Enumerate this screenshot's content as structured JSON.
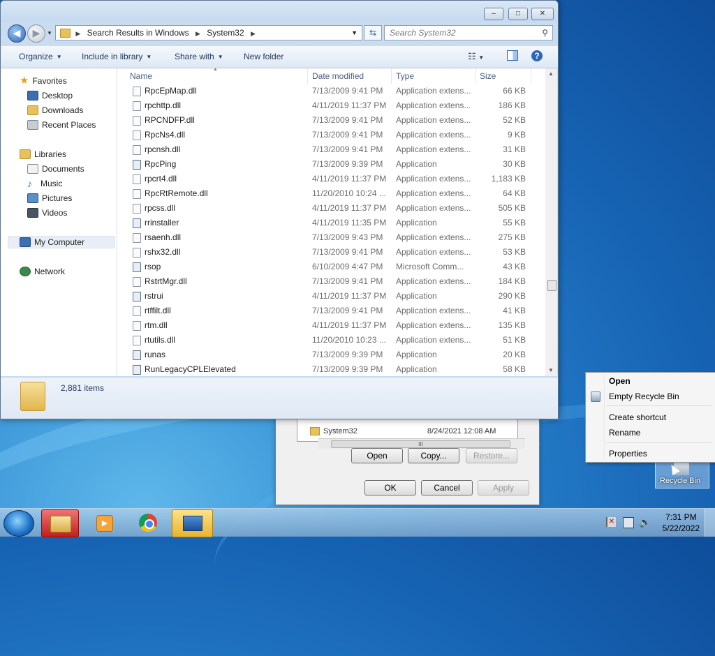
{
  "explorer": {
    "breadcrumb": [
      "Search Results in Windows",
      "System32"
    ],
    "search_placeholder": "Search System32",
    "commands": {
      "organize": "Organize",
      "include": "Include in library",
      "share": "Share with",
      "new_folder": "New folder"
    },
    "nav": {
      "favorites": "Favorites",
      "desktop": "Desktop",
      "downloads": "Downloads",
      "recent": "Recent Places",
      "libraries": "Libraries",
      "documents": "Documents",
      "music": "Music",
      "pictures": "Pictures",
      "videos": "Videos",
      "computer": "My Computer",
      "network": "Network"
    },
    "columns": {
      "name": "Name",
      "date": "Date modified",
      "type": "Type",
      "size": "Size"
    },
    "files": [
      {
        "name": "RpcEpMap.dll",
        "date": "7/13/2009 9:41 PM",
        "type": "Application extens...",
        "size": "66 KB",
        "kind": "dll"
      },
      {
        "name": "rpchttp.dll",
        "date": "4/11/2019 11:37 PM",
        "type": "Application extens...",
        "size": "186 KB",
        "kind": "dll"
      },
      {
        "name": "RPCNDFP.dll",
        "date": "7/13/2009 9:41 PM",
        "type": "Application extens...",
        "size": "52 KB",
        "kind": "dll"
      },
      {
        "name": "RpcNs4.dll",
        "date": "7/13/2009 9:41 PM",
        "type": "Application extens...",
        "size": "9 KB",
        "kind": "dll"
      },
      {
        "name": "rpcnsh.dll",
        "date": "7/13/2009 9:41 PM",
        "type": "Application extens...",
        "size": "31 KB",
        "kind": "dll"
      },
      {
        "name": "RpcPing",
        "date": "7/13/2009 9:39 PM",
        "type": "Application",
        "size": "30 KB",
        "kind": "app"
      },
      {
        "name": "rpcrt4.dll",
        "date": "4/11/2019 11:37 PM",
        "type": "Application extens...",
        "size": "1,183 KB",
        "kind": "dll"
      },
      {
        "name": "RpcRtRemote.dll",
        "date": "11/20/2010 10:24 ...",
        "type": "Application extens...",
        "size": "64 KB",
        "kind": "dll"
      },
      {
        "name": "rpcss.dll",
        "date": "4/11/2019 11:37 PM",
        "type": "Application extens...",
        "size": "505 KB",
        "kind": "dll"
      },
      {
        "name": "rrinstaller",
        "date": "4/11/2019 11:35 PM",
        "type": "Application",
        "size": "55 KB",
        "kind": "app"
      },
      {
        "name": "rsaenh.dll",
        "date": "7/13/2009 9:43 PM",
        "type": "Application extens...",
        "size": "275 KB",
        "kind": "dll"
      },
      {
        "name": "rshx32.dll",
        "date": "7/13/2009 9:41 PM",
        "type": "Application extens...",
        "size": "53 KB",
        "kind": "dll"
      },
      {
        "name": "rsop",
        "date": "6/10/2009 4:47 PM",
        "type": "Microsoft Comm...",
        "size": "43 KB",
        "kind": "msc"
      },
      {
        "name": "RstrtMgr.dll",
        "date": "7/13/2009 9:41 PM",
        "type": "Application extens...",
        "size": "184 KB",
        "kind": "dll"
      },
      {
        "name": "rstrui",
        "date": "4/11/2019 11:37 PM",
        "type": "Application",
        "size": "290 KB",
        "kind": "app"
      },
      {
        "name": "rtffilt.dll",
        "date": "7/13/2009 9:41 PM",
        "type": "Application extens...",
        "size": "41 KB",
        "kind": "dll"
      },
      {
        "name": "rtm.dll",
        "date": "4/11/2019 11:37 PM",
        "type": "Application extens...",
        "size": "135 KB",
        "kind": "dll"
      },
      {
        "name": "rtutils.dll",
        "date": "11/20/2010 10:23 ...",
        "type": "Application extens...",
        "size": "51 KB",
        "kind": "dll"
      },
      {
        "name": "runas",
        "date": "7/13/2009 9:39 PM",
        "type": "Application",
        "size": "20 KB",
        "kind": "app"
      },
      {
        "name": "RunLegacyCPLElevated",
        "date": "7/13/2009 9:39 PM",
        "type": "Application",
        "size": "58 KB",
        "kind": "app"
      }
    ],
    "item_count": "2,881 items"
  },
  "background_dialog": {
    "row_name": "System32",
    "row_date": "8/24/2021 12:08 AM",
    "scroll_grip": "III",
    "buttons": {
      "open": "Open",
      "copy": "Copy...",
      "restore": "Restore...",
      "ok": "OK",
      "cancel": "Cancel",
      "apply": "Apply"
    }
  },
  "context_menu": {
    "open": "Open",
    "empty": "Empty Recycle Bin",
    "shortcut": "Create shortcut",
    "rename": "Rename",
    "properties": "Properties"
  },
  "desktop": {
    "recycle_bin": "Recycle Bin"
  },
  "taskbar": {
    "time": "7:31 PM",
    "date": "5/22/2022"
  },
  "colors": {
    "accent": "#2f68b8",
    "window_frame": "#c9dcf0",
    "command_text": "#1e395b"
  }
}
